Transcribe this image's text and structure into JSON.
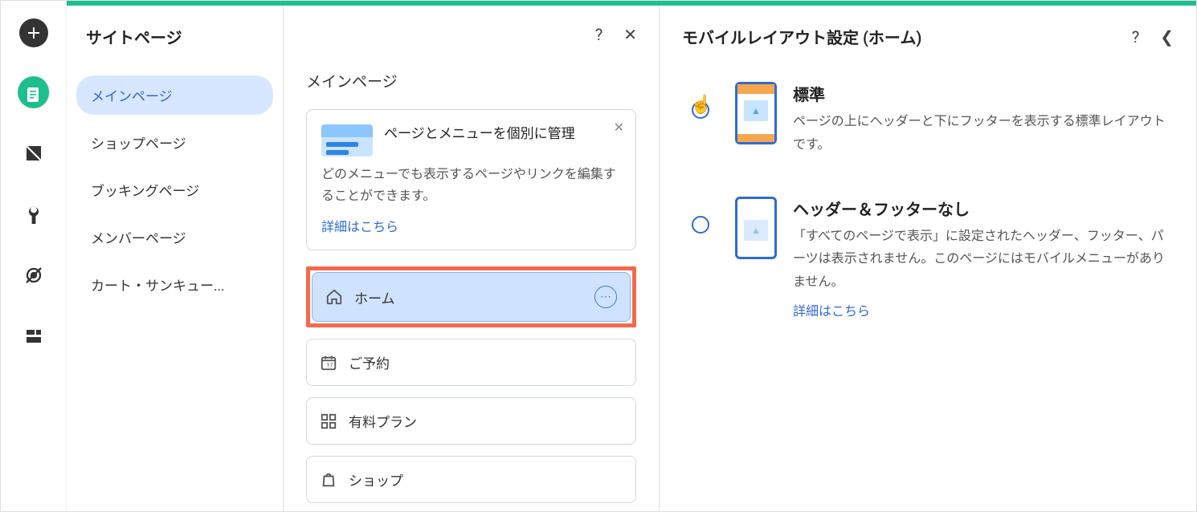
{
  "left_panel": {
    "title": "サイトページ",
    "categories": [
      {
        "label": "メインページ",
        "active": true
      },
      {
        "label": "ショップページ",
        "active": false
      },
      {
        "label": "ブッキングページ",
        "active": false
      },
      {
        "label": "メンバーページ",
        "active": false
      },
      {
        "label": "カート・サンキュー...",
        "active": false
      }
    ]
  },
  "middle_panel": {
    "heading": "メインページ",
    "info_card": {
      "title": "ページとメニューを個別に管理",
      "body": "どのメニューでも表示するページやリンクを編集することができます。",
      "link": "詳細はこちら"
    },
    "pages": [
      {
        "label": "ホーム",
        "icon": "home",
        "selected": true,
        "highlighted": true
      },
      {
        "label": "ご予約",
        "icon": "calendar",
        "selected": false,
        "highlighted": false
      },
      {
        "label": "有料プラン",
        "icon": "grid",
        "selected": false,
        "highlighted": false
      },
      {
        "label": "ショップ",
        "icon": "bag",
        "selected": false,
        "highlighted": false
      }
    ]
  },
  "right_panel": {
    "title": "モバイルレイアウト設定 (ホーム)",
    "options": [
      {
        "title": "標準",
        "desc": "ページの上にヘッダーと下にフッターを表示する標準レイアウトです。",
        "link": "",
        "checked": true,
        "phone_variant": "standard"
      },
      {
        "title": "ヘッダー＆フッターなし",
        "desc": "「すべてのページで表示」に設定されたヘッダー、フッター、パーツは表示されません。このページにはモバイルメニューがありません。",
        "link": "詳細はこちら",
        "checked": false,
        "phone_variant": "nohf"
      }
    ]
  }
}
